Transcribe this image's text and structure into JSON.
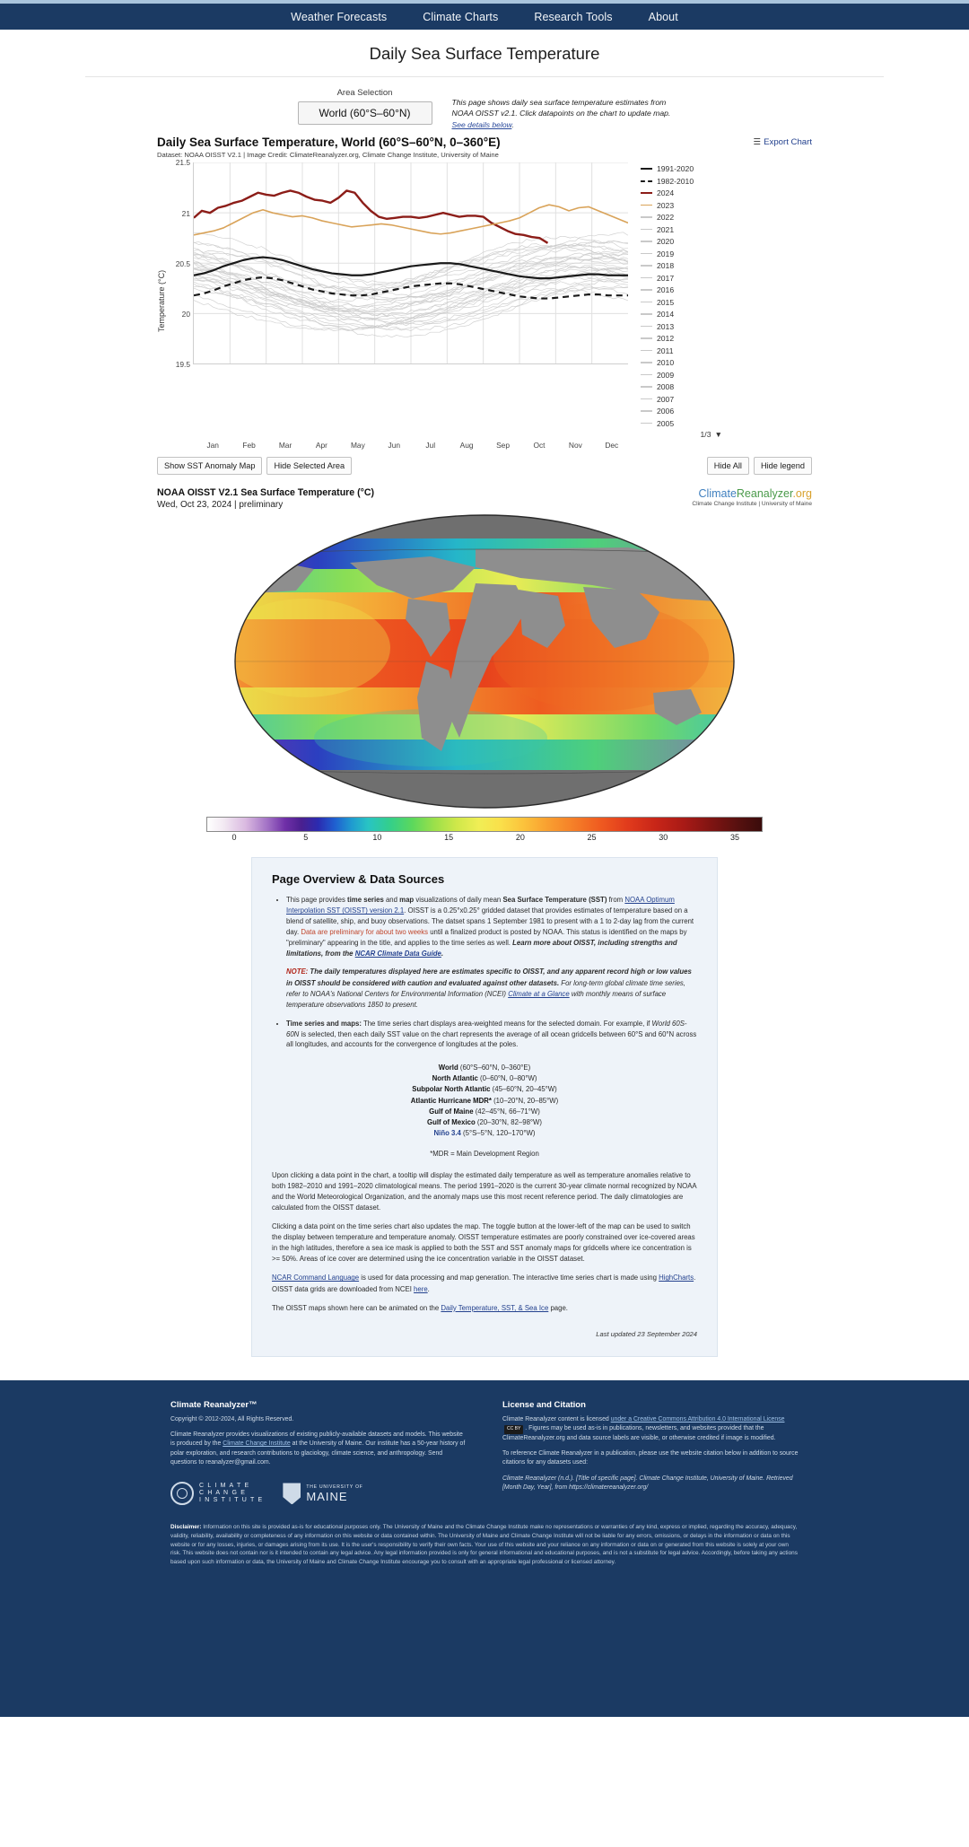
{
  "nav": {
    "items": [
      {
        "label": "Weather Forecasts"
      },
      {
        "label": "Climate Charts"
      },
      {
        "label": "Research Tools"
      },
      {
        "label": "About"
      }
    ]
  },
  "page": {
    "title": "Daily Sea Surface Temperature"
  },
  "controls": {
    "area_label": "Area Selection",
    "area_value": "World (60°S–60°N)",
    "blurb_1": "This page shows daily sea surface temperature estimates from NOAA OISST v2.1. Click datapoints on the chart to update map. ",
    "blurb_link": "See details below",
    "blurb_2": "."
  },
  "chart_data": {
    "type": "line",
    "title": "Daily Sea Surface Temperature, World (60°S–60°N, 0–360°E)",
    "subtitle": "Dataset: NOAA OISST V2.1 | Image Credit: ClimateReanalyzer.org, Climate Change Institute, University of Maine",
    "export_label": "Export Chart",
    "export_icon": "hamburger-icon",
    "xlabel": "",
    "ylabel": "Temperature (°C)",
    "ylim": [
      19.5,
      21.5
    ],
    "yticks": [
      19.5,
      20,
      20.5,
      21,
      21.5
    ],
    "ytick_labels": [
      "19.5",
      "20",
      "20.5",
      "21",
      "21.5"
    ],
    "grid": true,
    "legend_position": "right",
    "categories": [
      "Jan",
      "Feb",
      "Mar",
      "Apr",
      "May",
      "Jun",
      "Jul",
      "Aug",
      "Sep",
      "Oct",
      "Nov",
      "Dec"
    ],
    "legend": [
      {
        "label": "1991-2020",
        "color": "#1a1a1a",
        "style": "solid",
        "width": 2.2
      },
      {
        "label": "1982-2010",
        "color": "#1a1a1a",
        "style": "dashed",
        "width": 2.2
      },
      {
        "label": "2024",
        "color": "#8c1d18",
        "style": "solid",
        "width": 2.2
      },
      {
        "label": "2023",
        "color": "#d9a359",
        "style": "solid",
        "width": 1.6
      },
      {
        "label": "2022",
        "color": "#c9c9c9",
        "style": "solid",
        "width": 1
      },
      {
        "label": "2021",
        "color": "#c9c9c9",
        "style": "solid",
        "width": 1
      },
      {
        "label": "2020",
        "color": "#c9c9c9",
        "style": "solid",
        "width": 1
      },
      {
        "label": "2019",
        "color": "#c9c9c9",
        "style": "solid",
        "width": 1
      },
      {
        "label": "2018",
        "color": "#c9c9c9",
        "style": "solid",
        "width": 1
      },
      {
        "label": "2017",
        "color": "#c9c9c9",
        "style": "solid",
        "width": 1
      },
      {
        "label": "2016",
        "color": "#c9c9c9",
        "style": "solid",
        "width": 1
      },
      {
        "label": "2015",
        "color": "#c9c9c9",
        "style": "solid",
        "width": 1
      },
      {
        "label": "2014",
        "color": "#c9c9c9",
        "style": "solid",
        "width": 1
      },
      {
        "label": "2013",
        "color": "#c9c9c9",
        "style": "solid",
        "width": 1
      },
      {
        "label": "2012",
        "color": "#c9c9c9",
        "style": "solid",
        "width": 1
      },
      {
        "label": "2011",
        "color": "#c9c9c9",
        "style": "solid",
        "width": 1
      },
      {
        "label": "2010",
        "color": "#c9c9c9",
        "style": "solid",
        "width": 1
      },
      {
        "label": "2009",
        "color": "#c9c9c9",
        "style": "solid",
        "width": 1
      },
      {
        "label": "2008",
        "color": "#c9c9c9",
        "style": "solid",
        "width": 1
      },
      {
        "label": "2007",
        "color": "#c9c9c9",
        "style": "solid",
        "width": 1
      },
      {
        "label": "2006",
        "color": "#c9c9c9",
        "style": "solid",
        "width": 1
      },
      {
        "label": "2005",
        "color": "#c9c9c9",
        "style": "solid",
        "width": 1
      }
    ],
    "legend_pager": "1/3",
    "series": [
      {
        "name": "2024",
        "color": "#8c1d18",
        "values": [
          20.95,
          21.02,
          21.0,
          21.05,
          21.07,
          21.1,
          21.12,
          21.16,
          21.2,
          21.18,
          21.17,
          21.2,
          21.22,
          21.2,
          21.16,
          21.13,
          21.12,
          21.1,
          21.15,
          21.22,
          21.2,
          21.1,
          21.02,
          20.96,
          20.94,
          20.95,
          20.96,
          20.96,
          20.95,
          20.96,
          20.98,
          21.0,
          20.98,
          20.96,
          20.97,
          20.97,
          20.96,
          20.9,
          20.86,
          20.82,
          20.79,
          20.78,
          20.76,
          20.75,
          20.7
        ]
      },
      {
        "name": "2023",
        "color": "#d9a359",
        "values": [
          20.78,
          20.8,
          20.82,
          20.85,
          20.9,
          20.95,
          21.0,
          21.03,
          21.0,
          20.98,
          20.96,
          20.97,
          20.95,
          20.92,
          20.9,
          20.88,
          20.86,
          20.87,
          20.88,
          20.89,
          20.88,
          20.86,
          20.84,
          20.82,
          20.8,
          20.79,
          20.8,
          20.82,
          20.84,
          20.86,
          20.88,
          20.9,
          20.92,
          20.95,
          21.0,
          21.05,
          21.08,
          21.06,
          21.02,
          21.05,
          21.06,
          21.02,
          20.98,
          20.94,
          20.9
        ]
      },
      {
        "name": "1991-2020",
        "color": "#1a1a1a",
        "style": "solid",
        "values": [
          20.38,
          20.4,
          20.43,
          20.47,
          20.5,
          20.53,
          20.55,
          20.56,
          20.55,
          20.53,
          20.5,
          20.47,
          20.44,
          20.42,
          20.4,
          20.39,
          20.38,
          20.38,
          20.39,
          20.41,
          20.43,
          20.45,
          20.47,
          20.48,
          20.49,
          20.5,
          20.5,
          20.49,
          20.47,
          20.45,
          20.43,
          20.41,
          20.39,
          20.37,
          20.36,
          20.35,
          20.35,
          20.36,
          20.37,
          20.38,
          20.39,
          20.39,
          20.38,
          20.38,
          20.38
        ]
      },
      {
        "name": "1982-2010",
        "color": "#1a1a1a",
        "style": "dashed",
        "values": [
          20.18,
          20.2,
          20.23,
          20.27,
          20.3,
          20.33,
          20.35,
          20.36,
          20.35,
          20.33,
          20.3,
          20.27,
          20.24,
          20.22,
          20.2,
          20.19,
          20.18,
          20.18,
          20.19,
          20.21,
          20.23,
          20.25,
          20.27,
          20.28,
          20.29,
          20.3,
          20.3,
          20.29,
          20.27,
          20.25,
          20.23,
          20.21,
          20.19,
          20.17,
          20.16,
          20.15,
          20.15,
          20.16,
          20.17,
          20.18,
          20.19,
          20.19,
          20.18,
          20.18,
          20.18
        ]
      }
    ]
  },
  "chart_buttons": {
    "left": [
      {
        "label": "Show SST Anomaly Map"
      },
      {
        "label": "Hide Selected Area"
      }
    ],
    "right": [
      {
        "label": "Hide All"
      },
      {
        "label": "Hide legend"
      }
    ]
  },
  "map": {
    "title": "NOAA OISST V2.1 Sea Surface Temperature (°C)",
    "date": "Wed, Oct 23, 2024 | preliminary",
    "brand_1a": "Climate",
    "brand_1b": "Reanalyzer",
    "brand_1c": ".org",
    "brand_2": "Climate Change Institute | University of Maine",
    "colorbar_ticks": [
      "0",
      "5",
      "10",
      "15",
      "20",
      "25",
      "30",
      "35"
    ]
  },
  "overview": {
    "heading": "Page Overview & Data Sources",
    "b1_a": "This page provides ",
    "b1_ts": "time series",
    "b1_b": " and ",
    "b1_map": "map",
    "b1_c": " visualizations of daily mean ",
    "b1_sst": "Sea Surface Temperature (SST)",
    "b1_d": " from ",
    "b1_link": "NOAA Optimum Interpolation SST (OISST) version 2.1",
    "b1_e": ". OISST is a 0.25°x0.25° gridded dataset that provides estimates of temperature based on a blend of satellite, ship, and buoy observations. The datset spans 1 September 1981 to present with a 1 to 2-day lag from the current day. ",
    "b1_red": "Data are preliminary for about two weeks",
    "b1_f": " until a finalized product is posted by NOAA. This status is identified on the maps by \"preliminary\" appearing in the title, and applies to the time series as well. ",
    "b1_bold": "Learn more about OISST, including strengths and limitations, from the ",
    "b1_bold_link": "NCAR Climate Data Guide",
    "b1_g": ".",
    "note_label": "NOTE:",
    "note_bold": " The daily temperatures displayed here are estimates specific to OISST, and any apparent record high or low values in OISST should be considered with caution and evaluated against other datasets.",
    "note_rest": " For long-term global climate time series, refer to NOAA's National Centers for Environmental Information (NCEI) ",
    "note_link": "Climate at a Glance",
    "note_rest2": " with monthly means of surface temperature observations 1850 to present.",
    "b2_bold": "Time series and maps:",
    "b2_text": " The time series chart displays area-weighted means for the selected domain. For example, if ",
    "b2_italic": "World 60S-60N",
    "b2_text2": " is selected, then each daily SST value on the chart represents the average of all ocean gridcells between 60°S and 60°N across all longitudes, and accounts for the convergence of longitudes at the poles.",
    "regions": [
      {
        "name": "World",
        "range": " (60°S–60°N, 0–360°E)"
      },
      {
        "name": "North Atlantic",
        "range": " (0–60°N, 0–80°W)"
      },
      {
        "name": "Subpolar North Atlantic",
        "range": " (45–60°N, 20–45°W)"
      },
      {
        "name": "Atlantic Hurricane MDR*",
        "range": " (10–20°N, 20–85°W)"
      },
      {
        "name": "Gulf of Maine",
        "range": " (42–45°N, 66–71°W)"
      },
      {
        "name": "Gulf of Mexico",
        "range": " (20–30°N, 82–98°W)"
      },
      {
        "name": "Niño 3.4",
        "range": " (5°S–5°N, 120–170°W)"
      }
    ],
    "mdr_note": "*MDR = Main Development Region",
    "p1": "Upon clicking a data point in the chart, a tooltip will display the estimated daily temperature as well as temperature anomalies relative to both 1982–2010 and 1991–2020 climatological means. The period 1991–2020 is the current 30-year climate normal recognized by NOAA and the World Meteorological Organization, and the anomaly maps use this most recent reference period. The daily climatologies are calculated from the OISST dataset.",
    "p2": "Clicking a data point on the time series chart also updates the map. The toggle button at the lower-left of the map can be used to switch the display between temperature and temperature anomaly. OISST temperature estimates are poorly constrained over ice-covered areas in the high latitudes, therefore a sea ice mask is applied to both the SST and SST anomaly maps for gridcells where ice concentration is >= 50%. Areas of ice cover are determined using the ice concentration variable in the OISST dataset.",
    "p3_link1": "NCAR Command Language",
    "p3_a": " is used for data processing and map generation. The interactive time series chart is made using ",
    "p3_link2": "HighCharts",
    "p3_b": ". OISST data grids are downloaded from NCEI ",
    "p3_link3": "here",
    "p3_c": ".",
    "p4_a": "The OISST maps shown here can be animated on the ",
    "p4_link": "Daily Temperature, SST, & Sea Ice",
    "p4_b": " page.",
    "last_updated": "Last updated 23 September 2024"
  },
  "footer": {
    "col1_title": "Climate Reanalyzer™",
    "col1_copy": "Copyright © 2012-2024, All Rights Reserved.",
    "col1_p1_a": "Climate Reanalyzer provides visualizations of existing publicly-available datasets and models. This website is produced by the ",
    "col1_p1_link": "Climate Change Institute",
    "col1_p1_b": " at the University of Maine. Our institute has a 50-year history of polar exploration, and research contributions to glaciology, climate science, and anthropology. Send questions to reanalyzer@gmail.com.",
    "cci_line1": "C L I M A T E",
    "cci_line2": "C H A N G E",
    "cci_line3": "I N S T I T U T E",
    "umaine": "MAINE",
    "umaine_small": "THE UNIVERSITY OF",
    "col2_title": "License and Citation",
    "col2_p1_a": "Climate Reanalyzer content is licensed ",
    "col2_p1_link1": "under a Creative Commons Attribution 4.0 International License",
    "col2_p1_badge": "CC BY",
    "col2_p1_b": ". Figures may be used as-is in publications, newsletters, and websites provided that the ClimateReanalyzer.org and data source labels are visible, or otherwise credited if image is modified.",
    "col2_p2": "To reference Climate Reanalyzer in a publication, please use the website citation below in addition to source citations for any datasets used:",
    "col2_cite": "Climate Reanalyzer (n.d.). [Title of specific page]. Climate Change Institute, University of Maine. Retrieved [Month Day, Year], from https://climatereanalyzer.org/",
    "disclaimer_label": "Disclaimer:",
    "disclaimer_text": " Information on this site is provided as-is for educational purposes only. The University of Maine and the Climate Change Institute make no representations or warranties of any kind, express or implied, regarding the accuracy, adequacy, validity, reliability, availability or completeness of any information on this website or data contained within. The University of Maine and Climate Change Institute will not be liable for any errors, omissions, or delays in the information or data on this website or for any losses, injuries, or damages arising from its use. It is the user's responsibility to verify their own facts. Your use of this website and your reliance on any information or data on or generated from this website is solely at your own risk. This website does not contain nor is it intended to contain any legal advice. Any legal information provided is only for general informational and educational purposes, and is not a substitute for legal advice. Accordingly, before taking any actions based upon such information or data, the University of Maine and Climate Change Institute encourage you to consult with an appropriate legal professional or licensed attorney."
  }
}
